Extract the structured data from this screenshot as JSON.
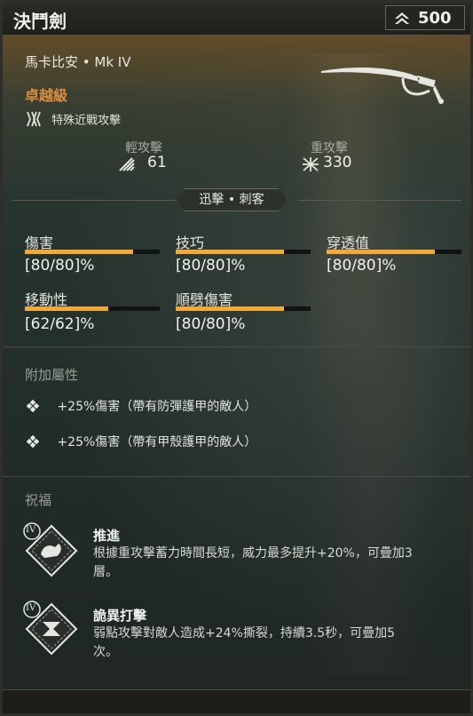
{
  "header": {
    "title": "決鬥劍",
    "currency_icon": "chevron-rank-icon",
    "currency_value": "500"
  },
  "weapon": {
    "name": "馬卡比安 • Mk IV",
    "rarity": "卓越級",
    "special_icon": "special-attack-icon",
    "special_label": "特殊近戰攻擊",
    "rarity_color": "#d98f3f"
  },
  "attacks": {
    "light_label": "輕攻擊",
    "light_value": "61",
    "heavy_label": "重攻擊",
    "heavy_value": "330"
  },
  "tag": "迅擊 • 刺客",
  "stats": [
    {
      "label": "傷害",
      "value": "[80/80]%",
      "fill": 0.8
    },
    {
      "label": "技巧",
      "value": "[80/80]%",
      "fill": 0.8
    },
    {
      "label": "穿透值",
      "value": "[80/80]%",
      "fill": 0.8
    },
    {
      "label": "移動性",
      "value": "[62/62]%",
      "fill": 0.62
    },
    {
      "label": "順劈傷害",
      "value": "[80/80]%",
      "fill": 0.8
    }
  ],
  "perks": {
    "title": "附加屬性",
    "items": [
      "+25%傷害（帶有防彈護甲的敵人）",
      "+25%傷害（帶有甲殼護甲的敵人）"
    ]
  },
  "blessings": {
    "title": "祝福",
    "items": [
      {
        "tier": "IV",
        "name": "推進",
        "desc": "根據重攻擊蓄力時間長短，威力最多提升+20%，可疊加3層。"
      },
      {
        "tier": "IV",
        "name": "詭異打擊",
        "desc": "弱點攻擊對敵人造成+24%撕裂，持續3.5秒，可疊加5次。"
      }
    ]
  },
  "colors": {
    "accent_bar": "#f2a83a",
    "rarity": "#d98f3f"
  }
}
